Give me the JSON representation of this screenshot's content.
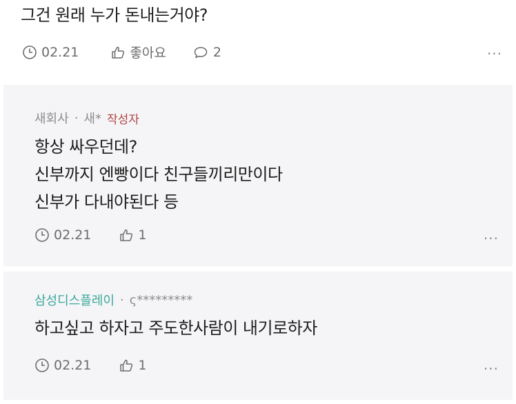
{
  "comment_1": {
    "text": "그건 원래 누가 돈내는거야?",
    "date": "02.21",
    "like_label": "좋아요",
    "reply_count": "2",
    "more": "..."
  },
  "reply_1": {
    "company": "새회사",
    "separator": "·",
    "author": "새*",
    "author_tag": "작성자",
    "lines": [
      "항상 싸우던데?",
      "신부까지 엔빵이다 친구들끼리만이다",
      "신부가 다내야된다 등"
    ],
    "date": "02.21",
    "like_count": "1",
    "more": "..."
  },
  "reply_2": {
    "company": "삼성디스플레이",
    "separator": "·",
    "author": "ς*********",
    "lines": [
      "하고싶고 하자고 주도한사람이 내기로하자"
    ],
    "date": "02.21",
    "like_count": "1",
    "more": "..."
  },
  "colors": {
    "reply_bg": "#f5f5f7",
    "author_tag": "#b04545",
    "company_green": "#3aa79a",
    "meta_gray": "#6b6b6b"
  },
  "icons": [
    "clock-icon",
    "thumbs-up-icon",
    "speech-bubble-icon",
    "more-icon"
  ]
}
